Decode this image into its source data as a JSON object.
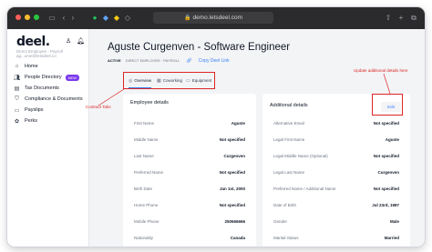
{
  "browser": {
    "url": "demo.letsdeel.com"
  },
  "sidebar": {
    "logo": "deel.",
    "user_role": "Direct Employee - Payroll",
    "user_email": "ag...urve@letsdeel.co",
    "items": [
      {
        "label": "Home",
        "icon": "home-icon"
      },
      {
        "label": "People Directory",
        "icon": "people-icon",
        "badge": "NEW"
      },
      {
        "label": "Tax Documents",
        "icon": "document-icon"
      },
      {
        "label": "Compliance & Documents",
        "icon": "shield-icon"
      },
      {
        "label": "Payslips",
        "icon": "payslip-icon"
      },
      {
        "label": "Perks",
        "icon": "gift-icon"
      }
    ]
  },
  "header": {
    "title": "Aguste Curgenven - Software Engineer",
    "status": "ACTIVE",
    "type": "DIRECT EMPLOYEE · PAYROLL",
    "copy_link": "Copy Deel Link"
  },
  "tabs": [
    {
      "label": "Overview",
      "icon": "overview-icon",
      "active": true
    },
    {
      "label": "Coworking",
      "icon": "coworking-icon",
      "active": false
    },
    {
      "label": "Equipment",
      "icon": "equipment-icon",
      "active": false
    }
  ],
  "employee_details": {
    "title": "Employee details",
    "rows": [
      {
        "label": "First Name",
        "value": "Aguste"
      },
      {
        "label": "Middle Name",
        "value": "Not specified"
      },
      {
        "label": "Last Name",
        "value": "Curgenven"
      },
      {
        "label": "Preferred Name",
        "value": "Not specified"
      },
      {
        "label": "Birth Date",
        "value": "Jan 1st, 2000"
      },
      {
        "label": "Home Phone",
        "value": "Not specified"
      },
      {
        "label": "Mobile Phone",
        "value": "250666666"
      },
      {
        "label": "Nationality",
        "value": "Canada"
      }
    ]
  },
  "additional_details": {
    "title": "Additional details",
    "edit_label": "Edit",
    "rows": [
      {
        "label": "Alternative Email",
        "value": "Not specified"
      },
      {
        "label": "Legal First Name",
        "value": "Aguste"
      },
      {
        "label": "Legal Middle Name (Optional)",
        "value": "Not specified"
      },
      {
        "label": "Legal Last Name",
        "value": "Curgenven"
      },
      {
        "label": "Preferred Name / Additional Name",
        "value": "Not specified"
      },
      {
        "label": "Date of Birth",
        "value": "Jul 23rd, 1987"
      },
      {
        "label": "Gender",
        "value": "Male"
      },
      {
        "label": "Marital Status",
        "value": "Married"
      }
    ]
  },
  "annotations": {
    "tabs_note": "Contract Tabs",
    "edit_note": "Update additional details here"
  },
  "colors": {
    "accent": "#3b82f6",
    "annotation": "#dc2626",
    "badge": "#7c3aed",
    "background": "#f3f4f6"
  }
}
